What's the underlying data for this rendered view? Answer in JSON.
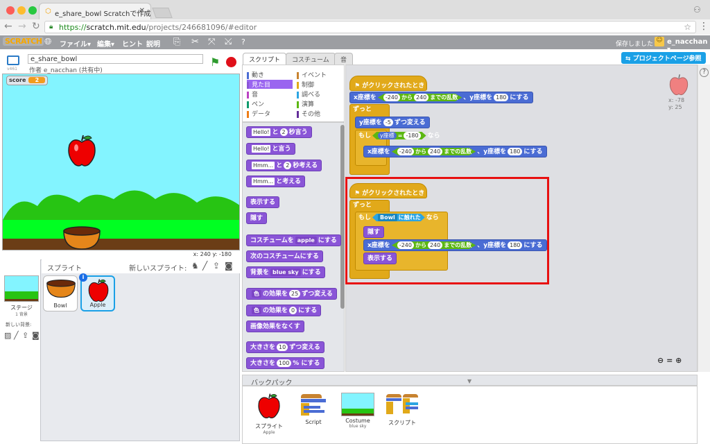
{
  "browser": {
    "tab_title": "e_share_bowl Scratchで作成",
    "url_scheme": "https://",
    "url_host": "scratch.mit.edu",
    "url_path": "/projects/246681096/#editor"
  },
  "menubar": {
    "logo": "SCRATCH",
    "file": "ファイル▾",
    "edit": "編集▾",
    "hints": "ヒント",
    "about": "説明",
    "saved": "保存しました",
    "user": "e_nacchan ▾"
  },
  "stage_header": {
    "version": "v461",
    "title": "e_share_bowl",
    "author": "作者 e_nacchan (共有中)"
  },
  "stage": {
    "score_label": "score",
    "score_value": "2",
    "coords": "x: 240   y: -180"
  },
  "sprites": {
    "title": "スプライト",
    "new_sprite": "新しいスプライト:",
    "stage_label": "ステージ",
    "stage_sub": "1 背景",
    "new_bg": "新しい背景:",
    "items": [
      {
        "name": "Bowl"
      },
      {
        "name": "Apple"
      }
    ]
  },
  "palette_tabs": {
    "scripts": "スクリプト",
    "costumes": "コスチューム",
    "sounds": "音"
  },
  "categories": {
    "left": [
      {
        "label": "動き",
        "color": "#4a6cd4"
      },
      {
        "label": "見た目",
        "color": "#8a55d7"
      },
      {
        "label": "音",
        "color": "#bb42c3"
      },
      {
        "label": "ペン",
        "color": "#0e9a6c"
      },
      {
        "label": "データ",
        "color": "#ee7d16"
      }
    ],
    "right": [
      {
        "label": "イベント",
        "color": "#c88330"
      },
      {
        "label": "制御",
        "color": "#e1a91a"
      },
      {
        "label": "調べる",
        "color": "#2ca5e2"
      },
      {
        "label": "演算",
        "color": "#5cb712"
      },
      {
        "label": "その他",
        "color": "#632d99"
      }
    ]
  },
  "palette_blocks": {
    "say_secs_1": "Hello!",
    "say_secs_2": "と",
    "say_secs_n": "2",
    "say_secs_3": "秒言う",
    "say_1": "Hello!",
    "say_2": "と言う",
    "think_secs_1": "Hmm...",
    "think_secs_2": "と",
    "think_secs_n": "2",
    "think_secs_3": "秒考える",
    "think_1": "Hmm...",
    "think_2": "と考える",
    "show": "表示する",
    "hide": "隠す",
    "costume_1": "コスチュームを",
    "costume_v": "apple",
    "costume_2": "にする",
    "next_costume": "次のコスチュームにする",
    "backdrop_1": "背景を",
    "backdrop_v": "blue sky",
    "backdrop_2": "にする",
    "effect_change_v": "色",
    "effect_change_1": "の効果を",
    "effect_change_n": "25",
    "effect_change_2": "ずつ変える",
    "effect_set_v": "色",
    "effect_set_1": "の効果を",
    "effect_set_n": "0",
    "effect_set_2": "にする",
    "clear_effects": "画像効果をなくす",
    "size_change_1": "大きさを",
    "size_change_n": "10",
    "size_change_2": "ずつ変える",
    "size_set_1": "大きさを",
    "size_set_n": "100",
    "size_set_2": "% にする"
  },
  "project_page_button": "プロジェクトページ参照",
  "sprite_corner": {
    "x": "x: -78",
    "y": "y: 25"
  },
  "script1": {
    "hat": "がクリックされたとき",
    "goto_1": "x座標を",
    "goto_n1": "-240",
    "goto_2": "から",
    "goto_n2": "240",
    "goto_3": "までの乱数",
    "goto_4": "、y座標を",
    "goto_n3": "180",
    "goto_5": "にする",
    "forever": "ずっと",
    "change_y_1": "y座標を",
    "change_y_n": "-5",
    "change_y_2": "ずつ変える",
    "if": "もし",
    "cond_1": "y座標",
    "cond_op": "=",
    "cond_n": "-180",
    "then": "なら",
    "in_goto_1": "x座標を",
    "in_goto_n1": "-240",
    "in_goto_2": "から",
    "in_goto_n2": "240",
    "in_goto_3": "までの乱数",
    "in_goto_4": "、y座標を",
    "in_goto_n3": "180",
    "in_goto_5": "にする"
  },
  "script2": {
    "hat": "がクリックされたとき",
    "forever": "ずっと",
    "if": "もし",
    "touch_v": "Bowl",
    "touch_2": "に触れた",
    "then": "なら",
    "hide": "隠す",
    "goto_1": "x座標を",
    "goto_n1": "-240",
    "goto_2": "から",
    "goto_n2": "240",
    "goto_3": "までの乱数",
    "goto_4": "、y座標を",
    "goto_n3": "180",
    "goto_5": "にする",
    "show": "表示する"
  },
  "backpack": {
    "title": "バックパック",
    "items": [
      {
        "label": "スプライト",
        "sub": "Apple"
      },
      {
        "label": "Script",
        "sub": ""
      },
      {
        "label": "Costume",
        "sub": "blue sky"
      },
      {
        "label": "スクリプト",
        "sub": ""
      }
    ]
  }
}
